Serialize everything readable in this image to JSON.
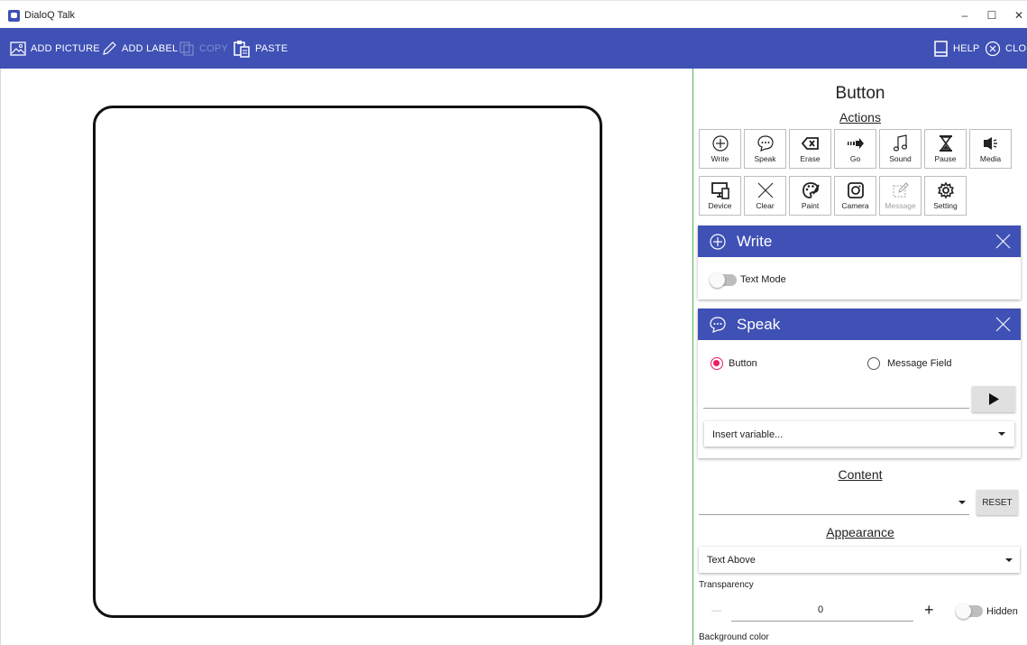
{
  "window": {
    "title": "DialoQ Talk",
    "minimize": "–",
    "maximize": "☐",
    "close": "✕"
  },
  "toolbar": {
    "add_picture": "ADD PICTURE",
    "add_label": "ADD LABEL",
    "copy": "COPY",
    "paste": "PASTE",
    "help": "HELP",
    "close": "CLOS"
  },
  "panel": {
    "title": "Button",
    "actions_heading": "Actions",
    "actions": [
      {
        "label": "Write",
        "icon": "circle-plus-icon"
      },
      {
        "label": "Speak",
        "icon": "speech-bubble-icon"
      },
      {
        "label": "Erase",
        "icon": "backspace-icon"
      },
      {
        "label": "Go",
        "icon": "arrow-right-icon"
      },
      {
        "label": "Sound",
        "icon": "music-note-icon"
      },
      {
        "label": "Pause",
        "icon": "hourglass-icon"
      },
      {
        "label": "Media",
        "icon": "speaker-icon"
      },
      {
        "label": "Device",
        "icon": "device-icon"
      },
      {
        "label": "Clear",
        "icon": "x-icon"
      },
      {
        "label": "Paint",
        "icon": "palette-icon"
      },
      {
        "label": "Camera",
        "icon": "camera-icon"
      },
      {
        "label": "Message",
        "icon": "message-edit-icon"
      },
      {
        "label": "Setting",
        "icon": "gear-icon"
      }
    ],
    "write_card": {
      "title": "Write",
      "text_mode_label": "Text Mode"
    },
    "speak_card": {
      "title": "Speak",
      "radio_button": "Button",
      "radio_message_field": "Message Field",
      "insert_variable_placeholder": "Insert variable..."
    },
    "content_heading": "Content",
    "reset_label": "RESET",
    "appearance_heading": "Appearance",
    "appearance_select": "Text Above",
    "transparency_label": "Transparency",
    "transparency_value": "0",
    "minus": "—",
    "plus": "+",
    "hidden_label": "Hidden",
    "background_color_label": "Background color"
  },
  "colors": {
    "accent": "#3f51b5",
    "radio_active": "#e91e63",
    "divider": "#56b356"
  }
}
